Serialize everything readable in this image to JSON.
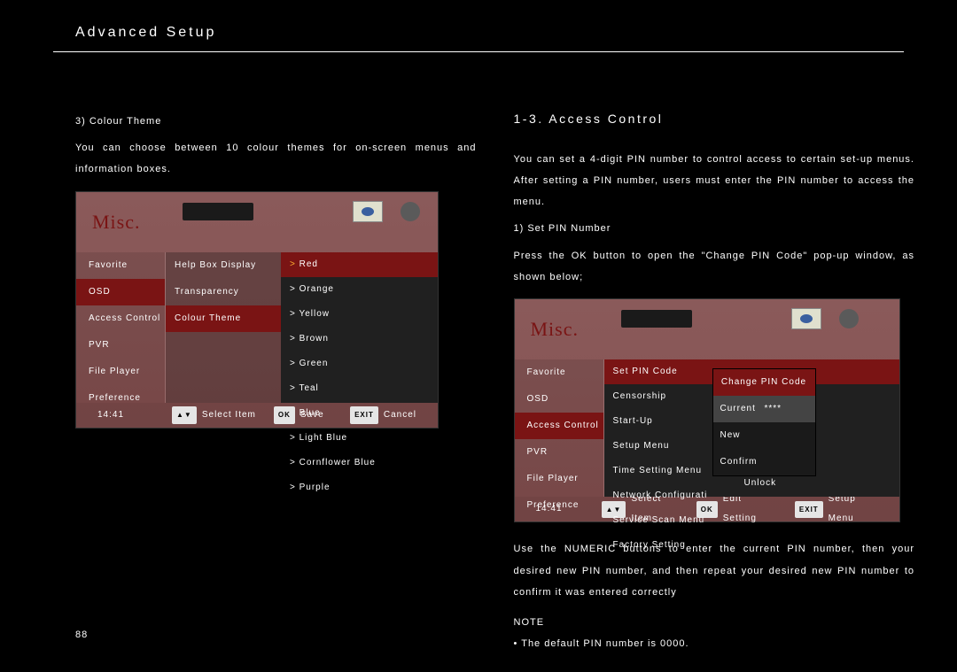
{
  "header": {
    "title": "Advanced Setup"
  },
  "page_number": "88",
  "left": {
    "subheading": "3) Colour Theme",
    "para": "You can choose between 10 colour themes for on-screen menus and information boxes."
  },
  "right": {
    "heading": "1-3. Access Control",
    "para1": "You can set a 4-digit PIN number to control access to certain set-up menus.  After setting a PIN number, users must enter the PIN number to access the menu.",
    "sub1": "1) Set PIN Number",
    "para2": "Press the OK button to open the \"Change PIN Code\" pop-up window, as shown below;",
    "para3": "Use the NUMERIC buttons to enter the current PIN number, then your desired new PIN number, and then repeat your desired new PIN number to confirm it was entered correctly",
    "note_label": "NOTE",
    "note_item": "The default PIN number is 0000."
  },
  "osd1": {
    "title": "Misc.",
    "sidebar": [
      "Favorite",
      "OSD",
      "Access Control",
      "PVR",
      "File Player",
      "Preference"
    ],
    "sidebar_sel": 1,
    "mid": [
      "Help Box Display",
      "Transparency",
      "Colour Theme"
    ],
    "mid_sel": 2,
    "colours": [
      "Red",
      "Orange",
      "Yellow",
      "Brown",
      "Green",
      "Teal",
      "Blue",
      "Light Blue",
      "Cornflower Blue",
      "Purple"
    ],
    "colour_sel": 0,
    "time": "14:41",
    "keys": {
      "updown": "▲▼",
      "ok": "OK",
      "exit": "EXIT"
    },
    "footer": {
      "select": "Select Item",
      "save": "Save",
      "cancel": "Cancel"
    }
  },
  "osd2": {
    "title": "Misc.",
    "sidebar": [
      "Favorite",
      "OSD",
      "Access Control",
      "PVR",
      "File Player",
      "Preference"
    ],
    "sidebar_sel": 2,
    "items": [
      "Set PIN Code",
      "Censorship",
      "Start-Up",
      "Setup Menu",
      "Time Setting Menu",
      "Network Configurati",
      "Service Scan Menu",
      "Factory Setting"
    ],
    "item_sel": 0,
    "value_unlock": "Unlock",
    "popup": {
      "title": "Change PIN Code",
      "current_label": "Current",
      "current_val": "****",
      "new_label": "New",
      "confirm_label": "Confirm"
    },
    "time": "14:41",
    "keys": {
      "updown": "▲▼",
      "ok": "OK",
      "exit": "EXIT"
    },
    "footer": {
      "select": "Select Item",
      "edit": "Edit Setting",
      "setup": "Setup Menu"
    }
  }
}
